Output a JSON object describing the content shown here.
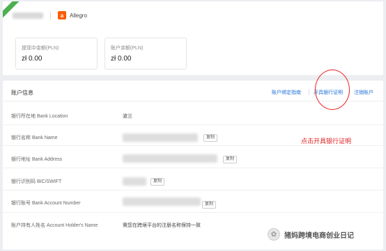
{
  "store": {
    "platform_label": "Allegro",
    "logo_letter": "a",
    "brand_color": "#ff5a00"
  },
  "balances": [
    {
      "label": "提现中金额(PLN)",
      "value": "zł 0.00"
    },
    {
      "label": "账户余额(PLN)",
      "value": "zł 0.00"
    }
  ],
  "account_info": {
    "title": "账户信息",
    "header_links": [
      "账户绑定指南",
      "开具银行证明",
      "注销账户"
    ],
    "link_color": "#1e6fd9",
    "rows": [
      {
        "label": "银行所在地  Bank Location",
        "value": "波兰"
      },
      {
        "label": "银行名称  Bank Name",
        "copy_label": "复制"
      },
      {
        "label": "银行地址  Bank Address",
        "copy_label": "复制"
      },
      {
        "label": "银行识别码  BIC/SWIFT",
        "copy_label": "复制"
      },
      {
        "label": "银行账号  Bank Account Number",
        "copy_label": "复制"
      },
      {
        "label": "账户持有人姓名  Account Holder's Name",
        "value": "需您在跨境平台的注册名称保持一致"
      }
    ]
  },
  "annotation": {
    "text": "点击开具银行证明",
    "color": "#e02020"
  },
  "watermark": {
    "text": "猪妈跨境电商创业日记"
  }
}
